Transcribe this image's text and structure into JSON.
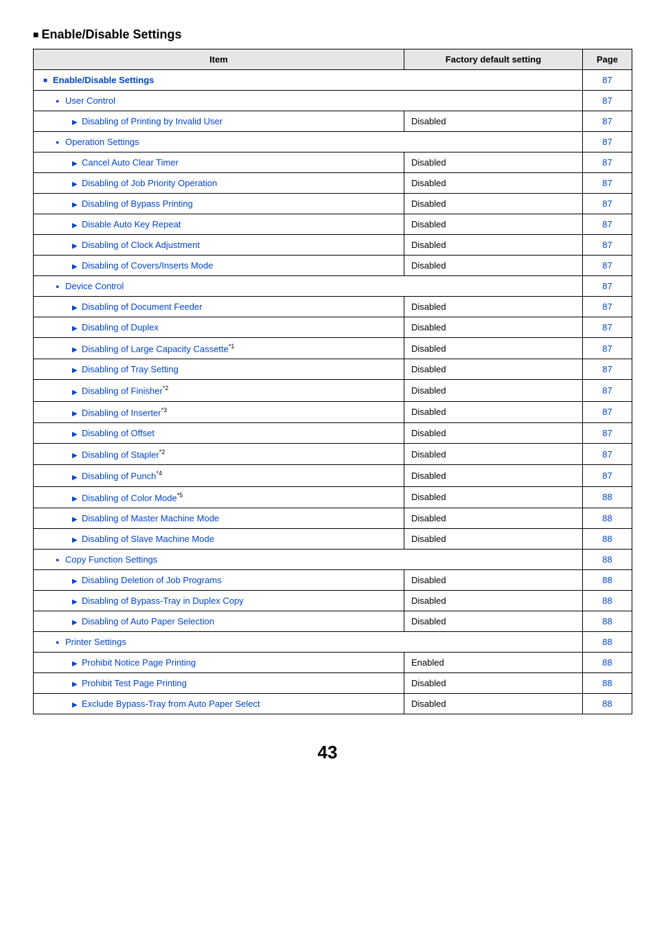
{
  "section_title": "Enable/Disable Settings",
  "table": {
    "headers": {
      "item": "Item",
      "factory": "Factory default setting",
      "page": "Page"
    },
    "rows": [
      {
        "level": 0,
        "marker": "sq",
        "label": "Enable/Disable Settings",
        "factory": "",
        "page": "87",
        "span": true
      },
      {
        "level": 1,
        "marker": "dot",
        "label": "User Control",
        "factory": "",
        "page": "87",
        "span": true
      },
      {
        "level": 2,
        "marker": "tri",
        "label": "Disabling of Printing by Invalid User",
        "factory": "Disabled",
        "page": "87"
      },
      {
        "level": 1,
        "marker": "dot",
        "label": "Operation Settings",
        "factory": "",
        "page": "87",
        "span": true
      },
      {
        "level": 2,
        "marker": "tri",
        "label": "Cancel Auto Clear Timer",
        "factory": "Disabled",
        "page": "87"
      },
      {
        "level": 2,
        "marker": "tri",
        "label": "Disabling of Job Priority Operation",
        "factory": "Disabled",
        "page": "87"
      },
      {
        "level": 2,
        "marker": "tri",
        "label": "Disabling of Bypass Printing",
        "factory": "Disabled",
        "page": "87"
      },
      {
        "level": 2,
        "marker": "tri",
        "label": "Disable Auto Key Repeat",
        "factory": "Disabled",
        "page": "87"
      },
      {
        "level": 2,
        "marker": "tri",
        "label": "Disabling of Clock Adjustment",
        "factory": "Disabled",
        "page": "87"
      },
      {
        "level": 2,
        "marker": "tri",
        "label": "Disabling of Covers/Inserts Mode",
        "factory": "Disabled",
        "page": "87"
      },
      {
        "level": 1,
        "marker": "dot",
        "label": "Device Control",
        "factory": "",
        "page": "87",
        "span": true
      },
      {
        "level": 2,
        "marker": "tri",
        "label": "Disabling of Document Feeder",
        "factory": "Disabled",
        "page": "87"
      },
      {
        "level": 2,
        "marker": "tri",
        "label": "Disabling of Duplex",
        "factory": "Disabled",
        "page": "87"
      },
      {
        "level": 2,
        "marker": "tri",
        "label": "Disabling of Large Capacity Cassette",
        "factory": "Disabled",
        "page": "87",
        "sup": "*1"
      },
      {
        "level": 2,
        "marker": "tri",
        "label": "Disabling of Tray Setting",
        "factory": "Disabled",
        "page": "87"
      },
      {
        "level": 2,
        "marker": "tri",
        "label": "Disabling of Finisher",
        "factory": "Disabled",
        "page": "87",
        "sup": "*2"
      },
      {
        "level": 2,
        "marker": "tri",
        "label": "Disabling of Inserter",
        "factory": "Disabled",
        "page": "87",
        "sup": "*3"
      },
      {
        "level": 2,
        "marker": "tri",
        "label": "Disabling of Offset",
        "factory": "Disabled",
        "page": "87"
      },
      {
        "level": 2,
        "marker": "tri",
        "label": "Disabling of Stapler",
        "factory": "Disabled",
        "page": "87",
        "sup": "*2"
      },
      {
        "level": 2,
        "marker": "tri",
        "label": "Disabling of Punch",
        "factory": "Disabled",
        "page": "87",
        "sup": "*4"
      },
      {
        "level": 2,
        "marker": "tri",
        "label": "Disabling of Color Mode",
        "factory": "Disabled",
        "page": "88",
        "sup": "*5"
      },
      {
        "level": 2,
        "marker": "tri",
        "label": "Disabling of Master Machine Mode",
        "factory": "Disabled",
        "page": "88"
      },
      {
        "level": 2,
        "marker": "tri",
        "label": "Disabling of Slave Machine Mode",
        "factory": "Disabled",
        "page": "88"
      },
      {
        "level": 1,
        "marker": "dot",
        "label": "Copy Function Settings",
        "factory": "",
        "page": "88",
        "span": true
      },
      {
        "level": 2,
        "marker": "tri",
        "label": "Disabling Deletion of Job Programs",
        "factory": "Disabled",
        "page": "88"
      },
      {
        "level": 2,
        "marker": "tri",
        "label": "Disabling of Bypass-Tray in Duplex Copy",
        "factory": "Disabled",
        "page": "88"
      },
      {
        "level": 2,
        "marker": "tri",
        "label": "Disabling of Auto Paper Selection",
        "factory": "Disabled",
        "page": "88"
      },
      {
        "level": 1,
        "marker": "dot",
        "label": "Printer Settings",
        "factory": "",
        "page": "88",
        "span": true
      },
      {
        "level": 2,
        "marker": "tri",
        "label": "Prohibit Notice Page Printing",
        "factory": "Enabled",
        "page": "88"
      },
      {
        "level": 2,
        "marker": "tri",
        "label": "Prohibit Test Page Printing",
        "factory": "Disabled",
        "page": "88"
      },
      {
        "level": 2,
        "marker": "tri",
        "label": "Exclude Bypass-Tray from Auto Paper Select",
        "factory": "Disabled",
        "page": "88"
      }
    ]
  },
  "page_number": "43"
}
